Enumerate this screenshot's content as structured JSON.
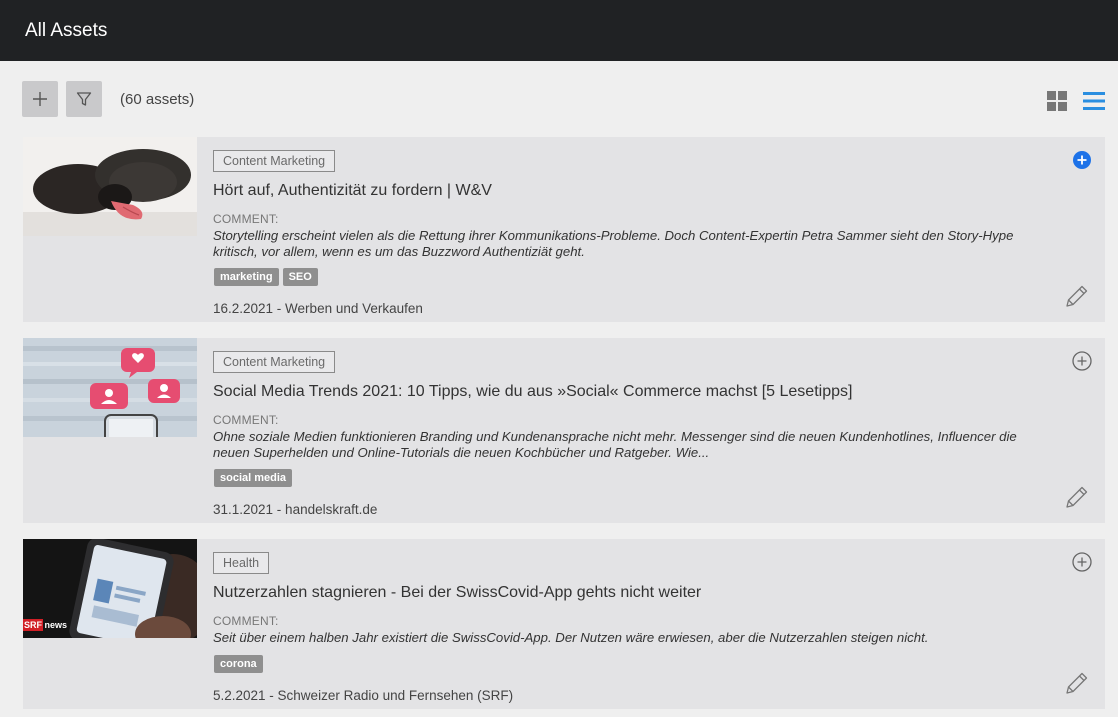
{
  "header": {
    "title": "All Assets"
  },
  "toolbar": {
    "add_icon": "plus-icon",
    "filter_icon": "filter-icon",
    "count": "(60 assets)",
    "grid_icon": "grid-view-icon",
    "list_icon": "list-view-icon",
    "active_view": "list",
    "accent_color": "#2a8ee0"
  },
  "assets": [
    {
      "category": "Content Marketing",
      "title": "Hört auf, Authentizität zu fordern | W&V",
      "comment_label": "COMMENT:",
      "comment": "Storytelling erscheint vielen als die Rettung ihrer Kommunikations-Probleme. Doch Content-Expertin Petra Sammer sieht den Story-Hype kritisch, vor allem, wenn es um das Buzzword Authentiziät geht.",
      "tags": [
        "marketing",
        "SEO"
      ],
      "meta": "16.2.2021 - Werben und Verkaufen",
      "added": true
    },
    {
      "category": "Content Marketing",
      "title": "Social Media Trends 2021: 10 Tipps, wie du aus »Social« Commerce machst [5 Lesetipps]",
      "comment_label": "COMMENT:",
      "comment": "Ohne soziale Medien funktionieren Branding und Kundenansprache nicht mehr. Messenger sind die neuen Kundenhotlines, Influencer die neuen Superhelden und Online-Tutorials die neuen Kochbücher und Ratgeber. Wie...",
      "tags": [
        "social media"
      ],
      "meta": "31.1.2021 - handelskraft.de",
      "added": false
    },
    {
      "category": "Health",
      "title": "Nutzerzahlen stagnieren - Bei der SwissCovid-App gehts nicht weiter",
      "comment_label": "COMMENT:",
      "comment": "Seit über einem halben Jahr existiert die SwissCovid-App. Der Nutzen wäre erwiesen, aber die Nutzerzahlen steigen nicht.",
      "tags": [
        "corona"
      ],
      "meta": "5.2.2021 - Schweizer Radio und Fernsehen (SRF)",
      "thumb_logo": "SRF news",
      "added": false
    }
  ]
}
